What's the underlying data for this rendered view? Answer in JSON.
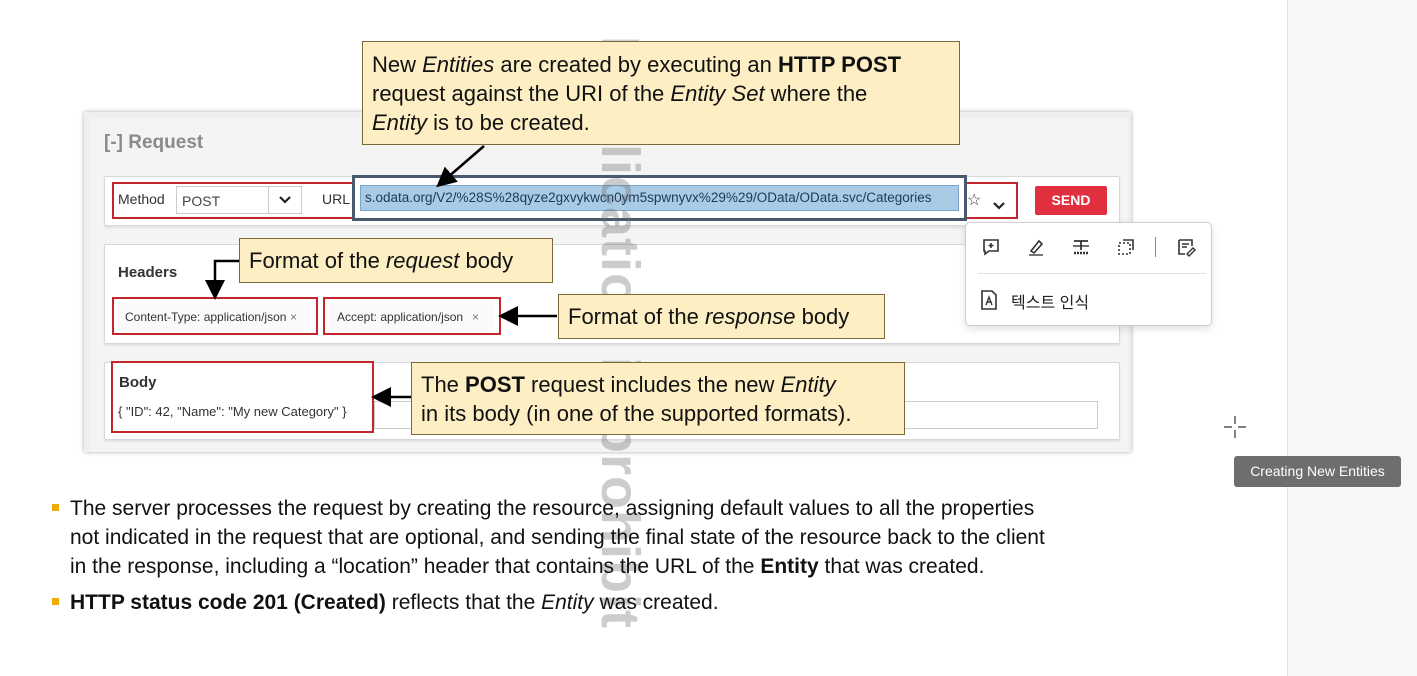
{
  "request_panel": {
    "title": "[-] Request",
    "method_label": "Method",
    "method_value": "POST",
    "url_label": "URL",
    "url_value": "s.odata.org/V2/%28S%28qyze2gxvykwcn0ym5spwnyvx%29%29/OData/OData.svc/Categories",
    "send_label": "SEND",
    "headers_label": "Headers",
    "header_tags": [
      {
        "text": "Content-Type: application/json",
        "remove": "×"
      },
      {
        "text": "Accept: application/json",
        "remove": "×"
      }
    ],
    "body_label": "Body",
    "body_value": "{ \"ID\": 42, \"Name\": \"My new Category\" }"
  },
  "callouts": {
    "top": {
      "line1": [
        "New ",
        "Entities",
        " are created by executing an ",
        "HTTP POST"
      ],
      "line2": [
        "request against the URI of the ",
        "Entity Set",
        " where the"
      ],
      "line3": [
        "Entity",
        " is to be created."
      ]
    },
    "request_format": [
      "Format of the ",
      "request",
      " body"
    ],
    "response_format": [
      "Format of the ",
      "response",
      " body"
    ],
    "post_body": {
      "line1": [
        "The ",
        "POST",
        " request includes the new ",
        "Entity"
      ],
      "line2": "in its body (in one of the supported formats)."
    }
  },
  "watermark": "Duplication is prohibit",
  "bullets": [
    {
      "line1": "The server processes the request by creating the resource, assigning default values to all the properties",
      "line2": "not indicated in the request that are optional, and sending the final state of the resource back to the client",
      "line3_parts": [
        "in the response, including a “location” header that contains the URL of the ",
        "Entity",
        " that was created."
      ]
    },
    {
      "parts": [
        "HTTP status code 201 (Created)",
        " reflects that the ",
        "Entity",
        " was created."
      ]
    }
  ],
  "popup": {
    "icons": [
      "add-comment-icon",
      "highlight-pen-icon",
      "strikethrough-icon",
      "select-area-icon",
      "notes-edit-icon"
    ],
    "ocr_label": "텍스트 인식",
    "ocr_icon": "text-recognition-icon"
  },
  "tooltip": "Creating New Entities",
  "colors": {
    "red_box": "#c0262b",
    "callout_bg": "#fdeec4",
    "send": "#e03040",
    "bullet": "#f0ab00",
    "url_highlight": "#a9cbe6"
  }
}
